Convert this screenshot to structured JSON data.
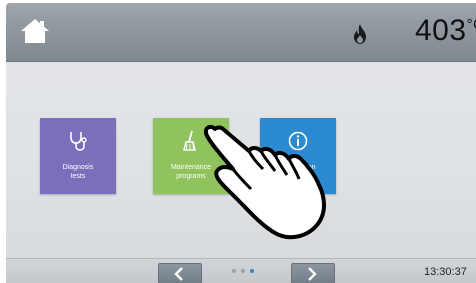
{
  "header": {
    "temperature_value": "403",
    "temperature_unit": "°C"
  },
  "tiles": [
    {
      "label_line1": "Diagnosis",
      "label_line2": "tests",
      "icon": "stethoscope-icon"
    },
    {
      "label_line1": "Maintenance",
      "label_line2": "programs",
      "icon": "broom-icon"
    },
    {
      "label_line1": "Information",
      "label_line2": "",
      "icon": "info-icon"
    }
  ],
  "footer": {
    "time": "13:30:37",
    "page_count": 3,
    "active_page": 3
  },
  "colors": {
    "diagnosis_tile": "#7b6fbb",
    "maintenance_tile": "#90c25d",
    "information_tile": "#2c8ad1",
    "header_bar": "#8c949c",
    "active_dot": "#3d7fc0"
  }
}
